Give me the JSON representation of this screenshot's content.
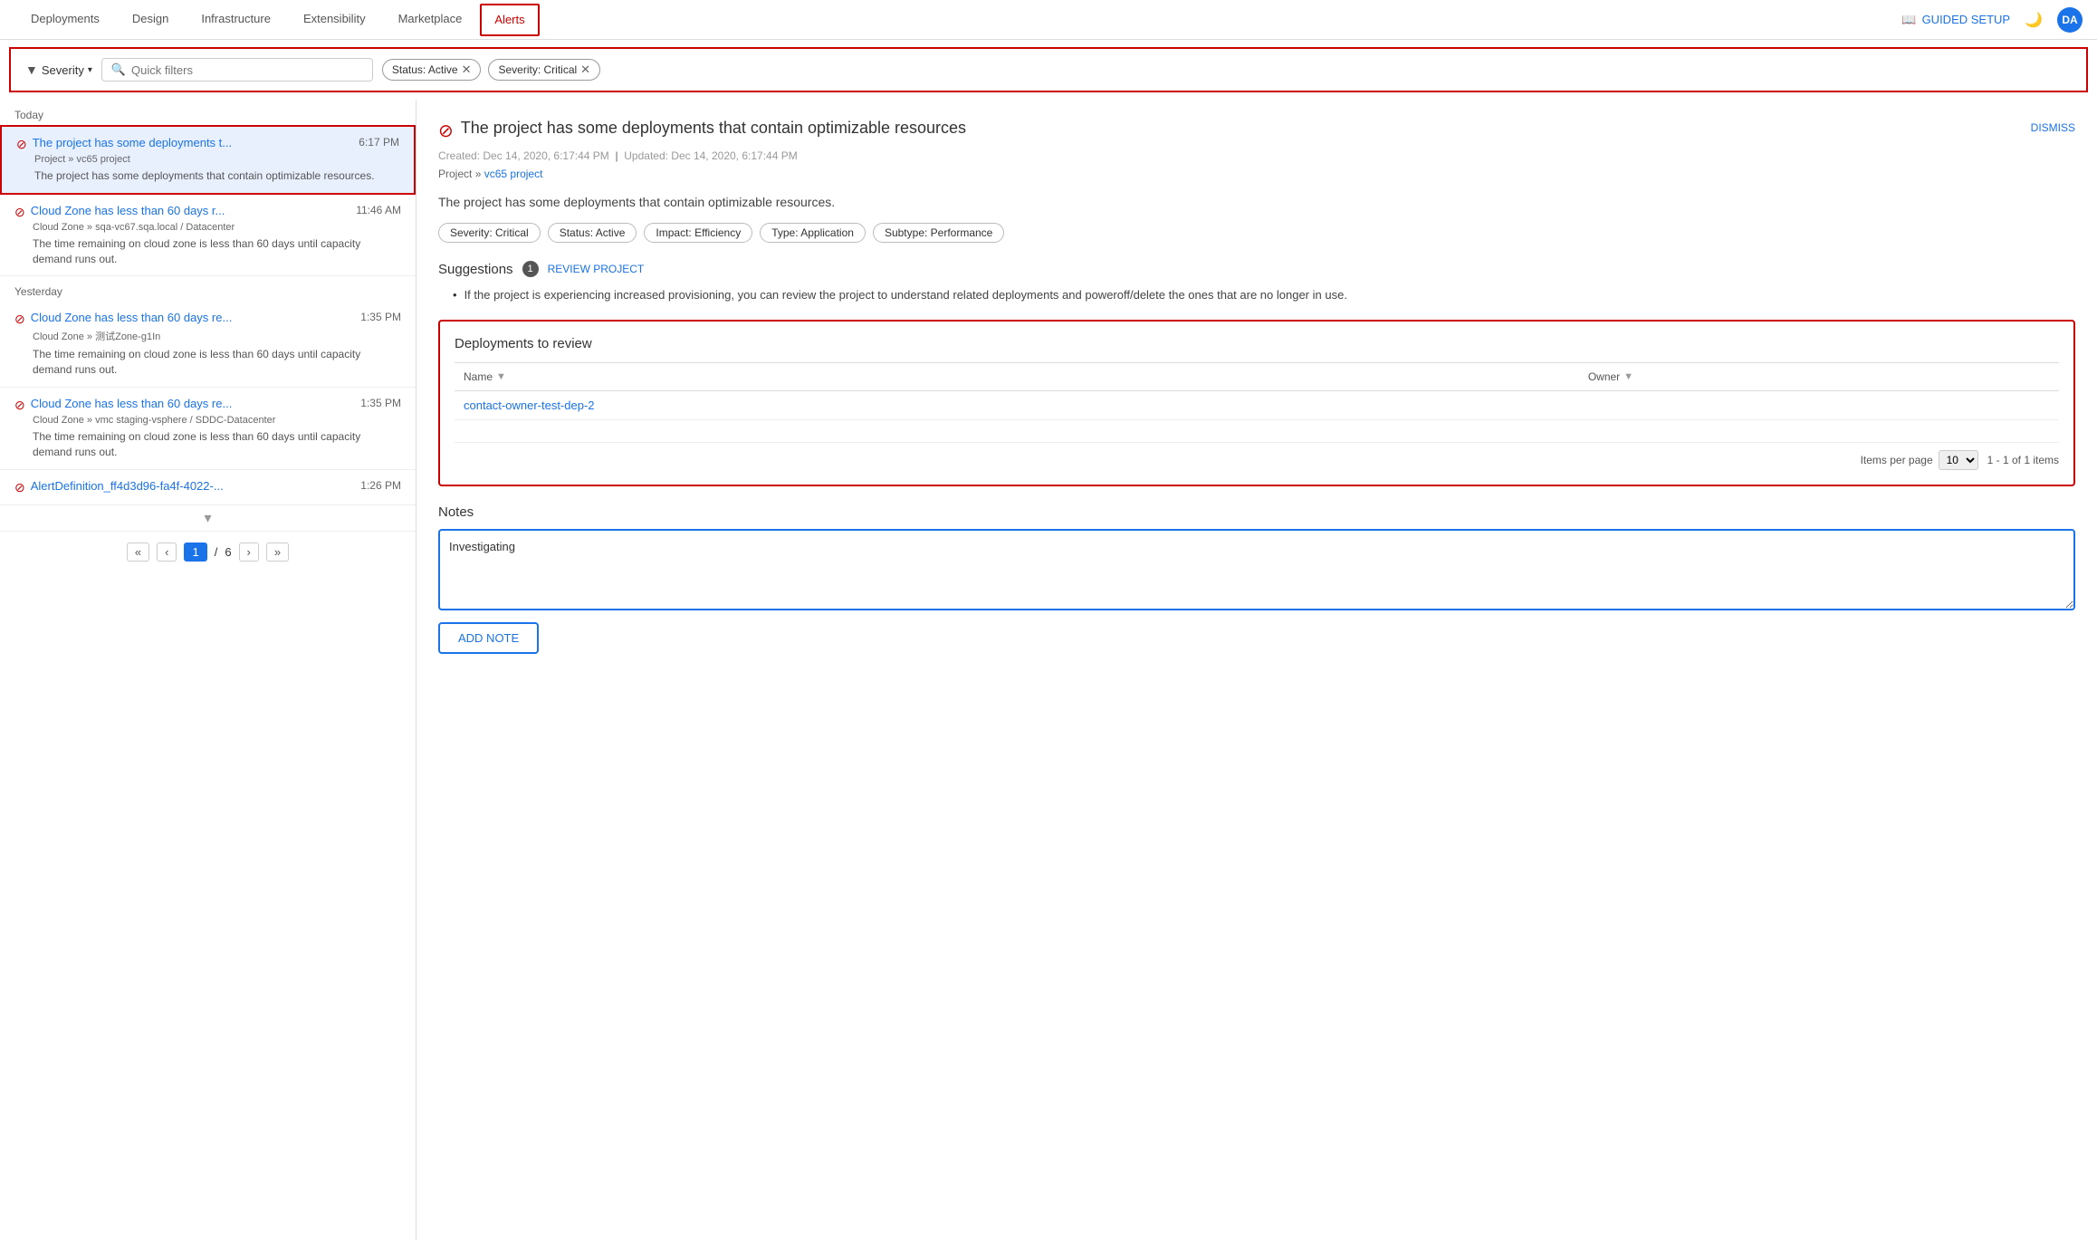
{
  "nav": {
    "items": [
      {
        "label": "Deployments",
        "active": false
      },
      {
        "label": "Design",
        "active": false
      },
      {
        "label": "Infrastructure",
        "active": false
      },
      {
        "label": "Extensibility",
        "active": false
      },
      {
        "label": "Marketplace",
        "active": false
      },
      {
        "label": "Alerts",
        "active": true
      }
    ],
    "guided_setup": "GUIDED SETUP",
    "avatar": "DA"
  },
  "filter_bar": {
    "severity_label": "Severity",
    "quick_filter_placeholder": "Quick filters",
    "chips": [
      {
        "label": "Status: Active",
        "id": "status-active"
      },
      {
        "label": "Severity: Critical",
        "id": "severity-critical"
      }
    ]
  },
  "alerts": {
    "today_label": "Today",
    "yesterday_label": "Yesterday",
    "today_items": [
      {
        "title": "The project has some deployments t...",
        "breadcrumb": "Project » vc65 project",
        "body": "The project has some deployments that contain optimizable resources.",
        "time": "6:17 PM",
        "selected": true
      },
      {
        "title": "Cloud Zone has less than 60 days r...",
        "breadcrumb": "Cloud Zone » sqa-vc67.sqa.local / Datacenter",
        "body": "The time remaining on cloud zone is less than 60 days until capacity demand runs out.",
        "time": "11:46 AM",
        "selected": false
      }
    ],
    "yesterday_items": [
      {
        "title": "Cloud Zone has less than 60 days re...",
        "breadcrumb": "Cloud Zone » 测试Zone-g1In",
        "body": "The time remaining on cloud zone is less than 60 days until capacity demand runs out.",
        "time": "1:35 PM",
        "selected": false
      },
      {
        "title": "Cloud Zone has less than 60 days re...",
        "breadcrumb": "Cloud Zone » vmc staging-vsphere / SDDC-Datacenter",
        "body": "The time remaining on cloud zone is less than 60 days until capacity demand runs out.",
        "time": "1:35 PM",
        "selected": false
      },
      {
        "title": "AlertDefinition_ff4d3d96-fa4f-4022-...",
        "breadcrumb": "",
        "body": "",
        "time": "1:26 PM",
        "selected": false
      }
    ],
    "pagination": {
      "prev_first": "«",
      "prev": "‹",
      "current_page": "1",
      "sep": "/",
      "total_pages": "6",
      "next": "›",
      "next_last": "»"
    }
  },
  "detail": {
    "critical_icon": "⊘",
    "title": "The project has some deployments that contain optimizable resources",
    "dismiss": "DISMISS",
    "created": "Created: Dec 14, 2020, 6:17:44 PM",
    "separator": "|",
    "updated": "Updated: Dec 14, 2020, 6:17:44 PM",
    "breadcrumb_label": "Project",
    "breadcrumb_link": "vc65 project",
    "description": "The project has some deployments that contain optimizable resources.",
    "tags": [
      "Severity: Critical",
      "Status: Active",
      "Impact: Efficiency",
      "Type: Application",
      "Subtype: Performance"
    ],
    "suggestions": {
      "label": "Suggestions",
      "count": "1",
      "review_btn": "REVIEW PROJECT",
      "text": "If the project is experiencing increased provisioning, you can review the project to understand related deployments and poweroff/delete the ones that are no longer in use."
    },
    "deployments": {
      "title": "Deployments to review",
      "columns": [
        "Name",
        "Owner"
      ],
      "rows": [
        {
          "name": "contact-owner-test-dep-2",
          "owner": ""
        }
      ],
      "items_per_page_label": "Items per page",
      "items_per_page": "10",
      "pagination": "1 - 1 of 1 items"
    },
    "notes": {
      "label": "Notes",
      "value": "Investigating",
      "add_note_btn": "ADD NOTE"
    }
  }
}
